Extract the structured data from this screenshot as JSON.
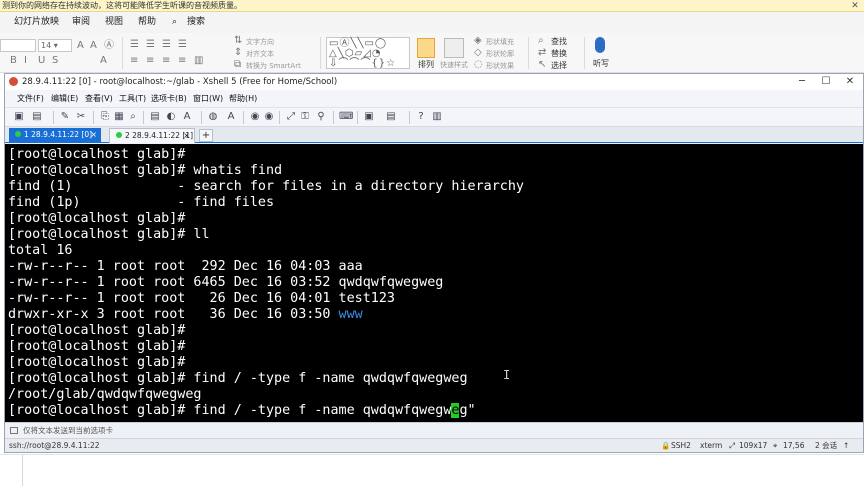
{
  "notification": {
    "text": "测到你的网络存在持续波动，这将可能降低学生听课的音视频质量。",
    "close": "✕"
  },
  "ppt_menu": [
    "幻灯片放映",
    "审阅",
    "视图",
    "帮助",
    "搜索"
  ],
  "ppt_ribbon": {
    "font_size": "14",
    "text_direction": "文字方向",
    "align_text": "对齐文本",
    "smartart": "转换为 SmartArt",
    "arrange": "排列",
    "quick_styles": "快速样式",
    "shape_fill": "形状填充",
    "shape_outline": "形状轮廓",
    "shape_effects": "形状效果",
    "find": "查找",
    "replace": "替换",
    "select": "选择",
    "dictate": "听写"
  },
  "xshell": {
    "title": "28.9.4.11:22 [0] - root@localhost:~/glab - Xshell 5 (Free for Home/School)",
    "menu": [
      "文件(F)",
      "编辑(E)",
      "查看(V)",
      "工具(T)",
      "选项卡(B)",
      "窗口(W)",
      "帮助(H)"
    ],
    "tabs": [
      {
        "label": "1 28.9.4.11:22 [0]",
        "close": "×",
        "active": true
      },
      {
        "label": "2 28.9.4.11:22 [1]",
        "close": "×",
        "active": false
      }
    ],
    "new_tab": "+",
    "terminal_lines": [
      "[root@localhost glab]#",
      "[root@localhost glab]# whatis find",
      "find (1)             - search for files in a directory hierarchy",
      "find (1p)            - find files",
      "[root@localhost glab]#",
      "[root@localhost glab]# ll",
      "total 16",
      "-rw-r--r-- 1 root root  292 Dec 16 04:03 aaa",
      "-rw-r--r-- 1 root root 6465 Dec 16 03:52 qwdqwfqwegweg",
      "-rw-r--r-- 1 root root   26 Dec 16 04:01 test123",
      "drwxr-xr-x 3 root root   36 Dec 16 03:50 ",
      "[root@localhost glab]#",
      "[root@localhost glab]#",
      "[root@localhost glab]#",
      "[root@localhost glab]# find / -type f -name qwdqwfqwegweg",
      "/root/glab/qwdqwfqwegweg"
    ],
    "blue_dir": "www",
    "last_line_before": "[root@localhost glab]# find / -type f -name qwdqwfqwegw",
    "last_line_cursor": "e",
    "last_line_after": "g\"",
    "compose_text": "仅将文本发送到当前选项卡",
    "status": {
      "host": "ssh://root@28.9.4.11:22",
      "protocol": "SSH2",
      "term": "xterm",
      "size": "109x17",
      "position": "17,56",
      "sessions": "2 会话"
    }
  },
  "colors": {
    "terminal_bg": "#000000",
    "terminal_fg": "#ffffff",
    "directory": "#3a8ee6",
    "cursor": "#22cc22",
    "active_tab": "#1a6fd6",
    "notify_bg": "#fdf4c8"
  }
}
